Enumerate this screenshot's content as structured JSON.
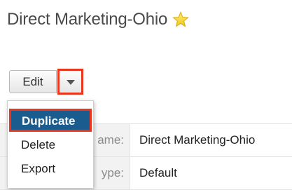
{
  "header": {
    "record_title": "Direct Marketing-Ohio",
    "favorite_icon": "star-icon",
    "favorite_color": "#f5d327"
  },
  "actions": {
    "edit_label": "Edit",
    "caret_icon": "chevron-down-icon",
    "highlight_color": "#e8361f"
  },
  "dropdown": {
    "items": [
      {
        "label": "Duplicate",
        "selected": true
      },
      {
        "label": "Delete"
      },
      {
        "label": "Export"
      }
    ],
    "selected_color": "#1b5c8f"
  },
  "details": {
    "rows": [
      {
        "label": "ame:",
        "value": "Direct Marketing-Ohio"
      },
      {
        "label": "ype:",
        "value": "Default"
      }
    ]
  }
}
